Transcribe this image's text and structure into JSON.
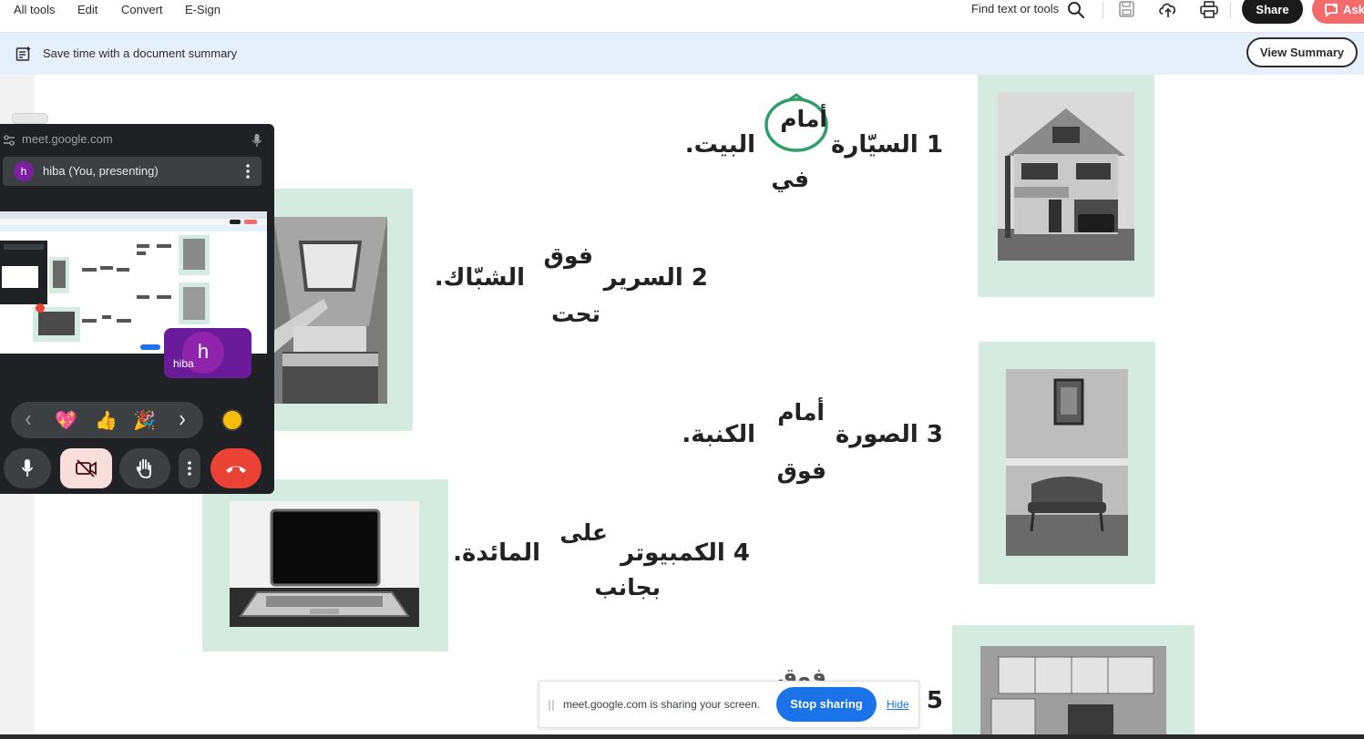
{
  "menu": {
    "all_tools": "All tools",
    "edit": "Edit",
    "convert": "Convert",
    "esign": "E-Sign",
    "find": "Find text or tools",
    "share": "Share",
    "ask": "Ask"
  },
  "banner": {
    "text": "Save time with a document summary",
    "button": "View Summary"
  },
  "exercise": {
    "s1": {
      "number": "1",
      "subject": "السيّارة",
      "options": [
        "أمام",
        "في"
      ],
      "object": "البيت."
    },
    "s2": {
      "number": "2",
      "subject": "السرير",
      "options": [
        "فوق",
        "تحت"
      ],
      "object": "الشبّاك."
    },
    "s3": {
      "number": "3",
      "subject": "الصورة",
      "options": [
        "أمام",
        "فوق"
      ],
      "object": "الكنبة."
    },
    "s4": {
      "number": "4",
      "subject": "الكمبيوتر",
      "options": [
        "على",
        "بجانب"
      ],
      "object": "المائدة."
    },
    "s5": {
      "number": "5",
      "options_partial": "فوق"
    }
  },
  "meet": {
    "url": "meet.google.com",
    "presenting": "hiba (You, presenting)",
    "avatar_letter": "h",
    "tile_letter": "h",
    "tile_name": "hiba",
    "reactions": [
      "💖",
      "👍",
      "🎉"
    ]
  },
  "sharebar": {
    "text": "meet.google.com is sharing your screen.",
    "stop": "Stop sharing",
    "hide": "Hide"
  },
  "colors": {
    "panel": "#d5ebe2",
    "banner": "#e5f0fc",
    "stop_button": "#1a73e8",
    "end_call": "#ea4335",
    "circle": "#2e9e6b"
  }
}
